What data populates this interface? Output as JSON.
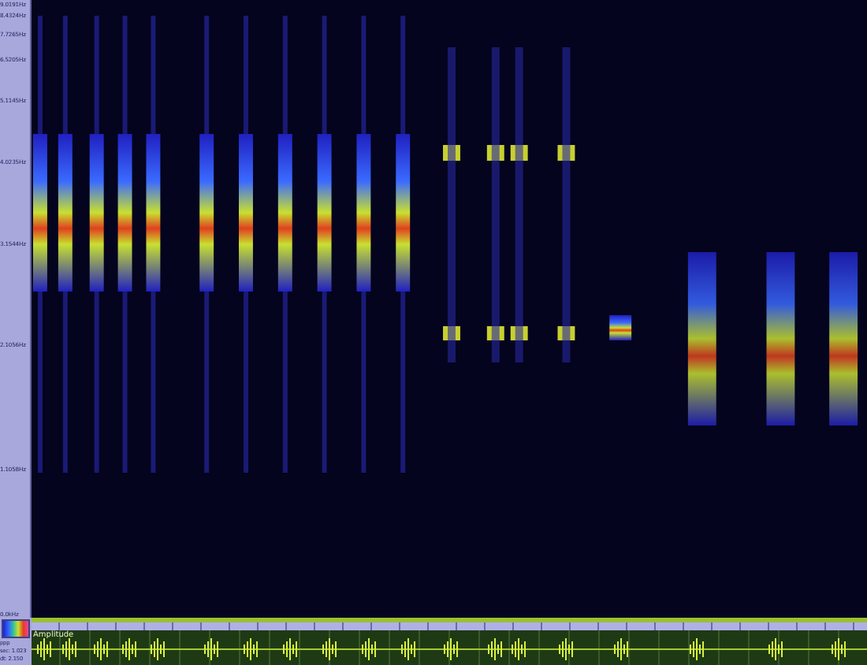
{
  "frequency_axis": {
    "labels": [
      "9.0191Hz",
      "8.4324Hz",
      "7.7265Hz",
      "6.5205Hz",
      "5.1145Hz",
      "4.0235Hz",
      "3.1544Hz",
      "2.1056Hz",
      "1.1058Hz",
      "0.0kHz"
    ]
  },
  "waveform": {
    "label": "Amplitude"
  },
  "info": {
    "lines": [
      "ppp",
      "sec: 1.023",
      "dt: 2.150"
    ]
  }
}
